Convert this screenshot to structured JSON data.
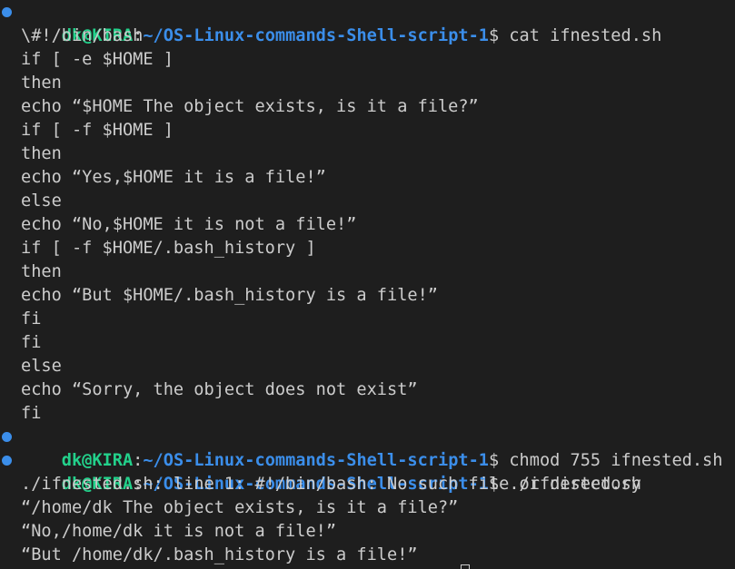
{
  "colors": {
    "background": "#1e1e1e",
    "text": "#cccccc",
    "user": "#23d18b",
    "path": "#3b8eea",
    "prompt_dot": "#3b8eea"
  },
  "prompt": {
    "user_host": "dk@KIRA",
    "separator": ":",
    "path": "~/OS-Linux-commands-Shell-script-1",
    "symbol": "$"
  },
  "commands": [
    " cat ifnested.sh",
    " chmod 755 ifnested.sh",
    " ./ifnested.sh"
  ],
  "file_lines": [
    "\\#!/bin/bash",
    "if [ -e $HOME ]",
    "then",
    "echo “$HOME The object exists, is it a file?”",
    "if [ -f $HOME ]",
    "then",
    "echo “Yes,$HOME it is a file!”",
    "else",
    "echo “No,$HOME it is not a file!”",
    "if [ -f $HOME/.bash_history ]",
    "then",
    "echo “But $HOME/.bash_history is a file!”",
    "fi",
    "fi",
    "else",
    "echo “Sorry, the object does not exist”",
    "fi"
  ],
  "run_output": [
    "./ifnested.sh: line 1: #!/bin/bash: No such file or directory",
    "“/home/dk The object exists, is it a file?”",
    "“No,/home/dk it is not a file!”",
    "“But /home/dk/.bash_history is a file!”"
  ]
}
